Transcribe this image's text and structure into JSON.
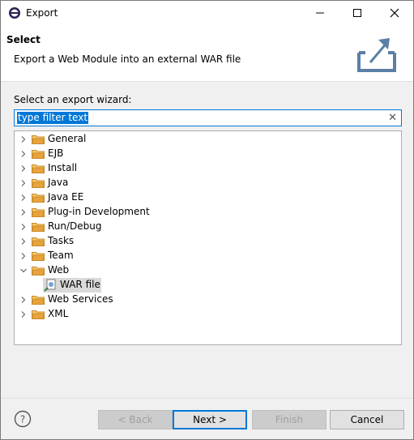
{
  "window": {
    "title": "Export"
  },
  "banner": {
    "title": "Select",
    "description": "Export a Web Module into an external WAR file",
    "icon": "export-icon"
  },
  "wizard": {
    "label": "Select an export wizard:",
    "filter_value": "type filter text",
    "clear_icon": "clear-icon"
  },
  "tree": {
    "items": [
      {
        "label": "General",
        "expanded": false
      },
      {
        "label": "EJB",
        "expanded": false
      },
      {
        "label": "Install",
        "expanded": false
      },
      {
        "label": "Java",
        "expanded": false
      },
      {
        "label": "Java EE",
        "expanded": false
      },
      {
        "label": "Plug-in Development",
        "expanded": false
      },
      {
        "label": "Run/Debug",
        "expanded": false
      },
      {
        "label": "Tasks",
        "expanded": false
      },
      {
        "label": "Team",
        "expanded": false
      },
      {
        "label": "Web",
        "expanded": true
      },
      {
        "label": "WAR file",
        "child": true,
        "selected": true
      },
      {
        "label": "Web Services",
        "expanded": false
      },
      {
        "label": "XML",
        "expanded": false
      }
    ]
  },
  "buttons": {
    "back": "< Back",
    "next": "Next >",
    "finish": "Finish",
    "cancel": "Cancel"
  },
  "colors": {
    "accent": "#0078d7",
    "folder": "#e8a33c",
    "selection": "#d9d9d9"
  }
}
